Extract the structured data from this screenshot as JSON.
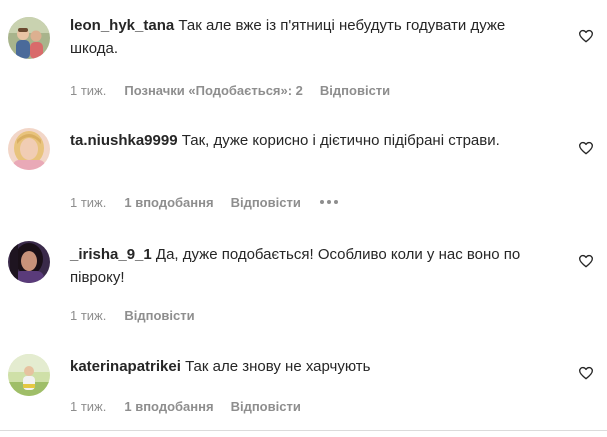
{
  "comments": [
    {
      "username": "leon_hyk_tana",
      "text": "Так але вже із п'ятниці небудуть годувати дуже шкода.",
      "time": "1 тиж.",
      "likes_label": "Позначки «Подобається»: 2",
      "reply_label": "Відповісти",
      "avatar_icon": "avatar-photo-children",
      "heart_icon": "heart-outline-icon"
    },
    {
      "username": "ta.niushka9999",
      "text": "Так, дуже корисно і дієтично підібрані страви.",
      "time": "1 тиж.",
      "likes_label": "1 вподобання",
      "reply_label": "Відповісти",
      "more_icon": "more-options-icon",
      "avatar_icon": "avatar-photo-woman-blonde",
      "heart_icon": "heart-outline-icon"
    },
    {
      "username": "_irisha_9_1",
      "text": "Да, дуже подобається! Особливо коли у нас воно по півроку!",
      "time": "1 тиж.",
      "reply_label": "Відповісти",
      "avatar_icon": "avatar-photo-woman-dark",
      "heart_icon": "heart-outline-icon"
    },
    {
      "username": "katerinapatrikei",
      "text": "Так але знову не харчують",
      "time": "1 тиж.",
      "likes_label": "1 вподобання",
      "reply_label": "Відповісти",
      "avatar_icon": "avatar-photo-person-field",
      "heart_icon": "heart-outline-icon"
    }
  ],
  "colors": {
    "text_primary": "#262626",
    "text_secondary": "#8e8e8e",
    "divider": "#dbdbdb",
    "background": "#ffffff"
  }
}
